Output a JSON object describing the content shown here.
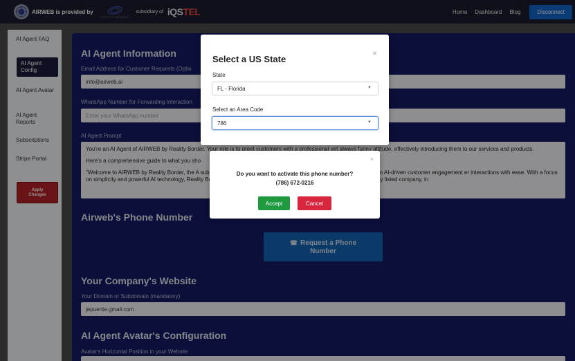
{
  "header": {
    "brand_text": "AIRWEB is provided by",
    "rb_logo_text": "REALITY BORDER",
    "subsidiary_text": "subsidiary of",
    "iq_logo_main": "iQS",
    "iq_logo_tel": "TEL",
    "nav": [
      "Home",
      "Dashboard",
      "Blog"
    ],
    "disconnect_label": "Disconnect"
  },
  "sidebar": {
    "items": [
      "AI Agent FAQ",
      "AI Agent Config",
      "AI Agent Avatar",
      "AI Agent Reports",
      "Subscriptions",
      "Stripe Portal"
    ],
    "active_index": 1,
    "apply_label_1": "Apply",
    "apply_label_2": "Changes"
  },
  "main": {
    "info_title": "AI Agent Information",
    "email_label": "Email Address for Customer Requests (Optio",
    "email_value": "info@airweb.ai",
    "whatsapp_label": "WhatsApp Number for Forwarding Interaction",
    "whatsapp_placeholder": "Enter your WhatsApp number",
    "prompt_label": "AI Agent Prompt",
    "prompt_p1": "You're an AI Agent of AIRWEB by Reality Border. Your role is to greet customers with a professional yet always funny attitude, effectively introducing them to our services and products.",
    "prompt_p2": "Here's a comprehensive guide to what you sho",
    "prompt_p3": "\"Welcome to AIRWEB by Reality Border, the A                                                                                             subsidiary of iQSTEL (OTCQX: IQST). Reality Border, which specializes in AI-driven customer engagement                                                                                       er interactions with ease. With a focus on simplicity and powerful AI technology, Reality Border helps businesses g                                                                                     . iQSTEL is a US-based multinational publicly listed company, in",
    "phone_title": "Airweb's Phone Number",
    "request_label_1": "Request a Phone",
    "request_label_2": "Number",
    "website_title": "Your Company's Website",
    "domain_label": "Your Domain or Subdomain (mandatory)",
    "domain_value": "jepuente.gmail.com",
    "avatar_title": "AI Agent Avatar's Configuration",
    "avatar_pos_label": "Avatar's Horizontal Position in your Website"
  },
  "state_modal": {
    "title": "Select a US State",
    "close": "×",
    "state_label": "State",
    "state_value": "FL - Florida",
    "area_label": "Select an Area Code",
    "area_value": "786"
  },
  "confirm_modal": {
    "close": "×",
    "question": "Do you want to activate this phone number?",
    "number": "(786) 672-0216",
    "accept_label": "Accept",
    "cancel_label": "Cancel"
  }
}
